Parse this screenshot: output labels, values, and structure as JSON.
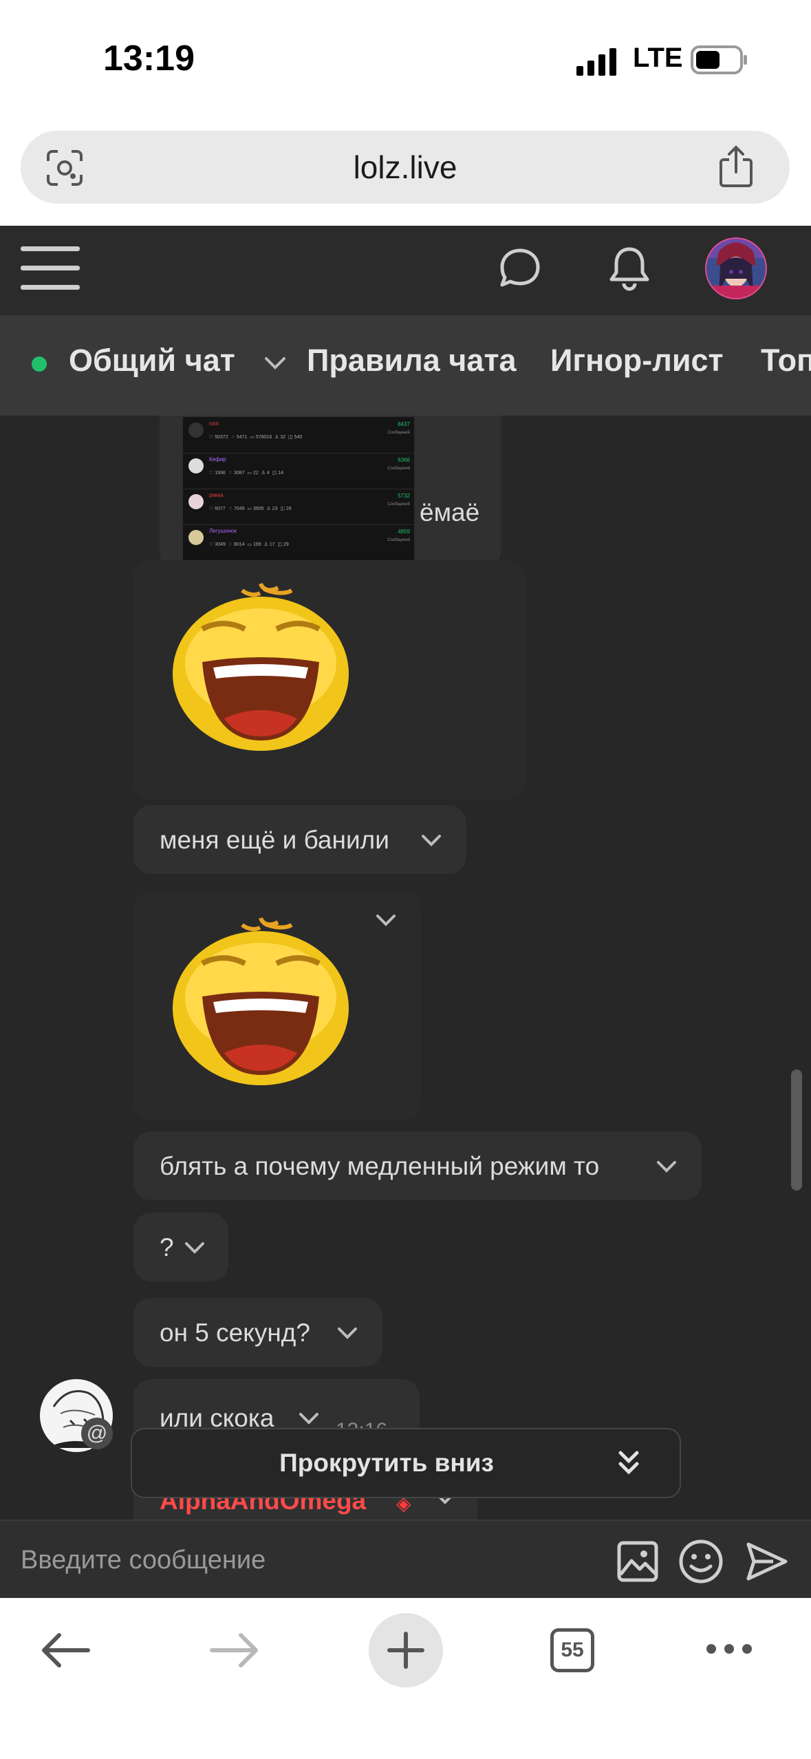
{
  "status": {
    "time": "13:19",
    "network": "LTE"
  },
  "browser": {
    "url": "lolz.live",
    "tab_count": "55"
  },
  "tabs": [
    "Общий чат",
    "Правила чата",
    "Игнор-лист",
    "Топ"
  ],
  "screenshot_preview": {
    "rows": [
      {
        "name": "root",
        "stats": [
          "50372",
          "5471",
          "578016",
          "32",
          "540"
        ],
        "count": "8437",
        "label": "Сообщений",
        "name_color": "#e23c3c"
      },
      {
        "name": "Кефир",
        "stats": [
          "1936",
          "3087",
          "22",
          "4",
          "14"
        ],
        "count": "6366",
        "label": "Сообщений",
        "name_color": "#b06cff"
      },
      {
        "name": "рикка",
        "stats": [
          "6077",
          "7049",
          "3605",
          "23",
          "26"
        ],
        "count": "5732",
        "label": "Сообщений",
        "name_color": "#e23c3c"
      },
      {
        "name": "Легушонок",
        "stats": [
          "3049",
          "8014",
          "169",
          "17",
          "29"
        ],
        "count": "4859",
        "label": "Сообщений",
        "name_color": "#b06cff"
      }
    ]
  },
  "messages": [
    {
      "text": "ёмаё"
    },
    {
      "text": "меня ещё и банили"
    },
    {
      "text": "блять а почему медленный режим то"
    },
    {
      "text": "?"
    },
    {
      "text": "он 5 секунд?"
    },
    {
      "text": "или скока",
      "time": "13:16"
    },
    {
      "text": "AlphaAndOmega"
    }
  ],
  "scroll_button": {
    "label": "Прокрутить вниз"
  },
  "composer": {
    "placeholder": "Введите сообщение"
  },
  "colors": {
    "online": "#21c16b",
    "accent_red": "#e23c3c",
    "background": "#272727"
  }
}
